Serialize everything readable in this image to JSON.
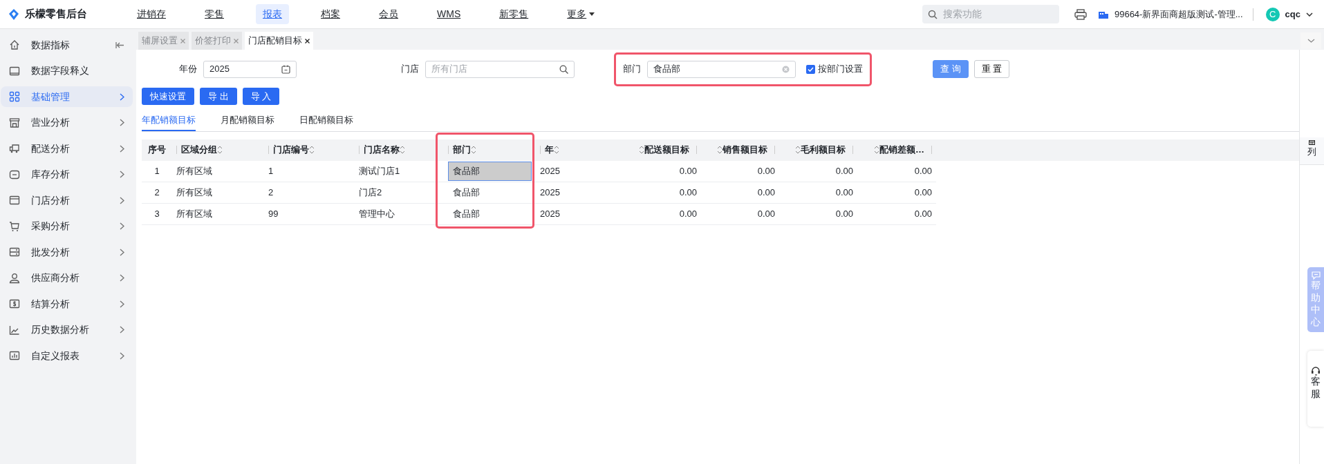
{
  "app": {
    "title": "乐檬零售后台"
  },
  "top_nav": [
    {
      "label": "进销存",
      "selected": false,
      "kind": "link"
    },
    {
      "label": "零售",
      "selected": false,
      "kind": "link"
    },
    {
      "label": "报表",
      "selected": true,
      "kind": "link"
    },
    {
      "label": "档案",
      "selected": false,
      "kind": "link"
    },
    {
      "label": "会员",
      "selected": false,
      "kind": "link"
    },
    {
      "label": "WMS",
      "selected": false,
      "kind": "link"
    },
    {
      "label": "新零售",
      "selected": false,
      "kind": "link"
    },
    {
      "label": "更多",
      "selected": false,
      "kind": "dropdown"
    }
  ],
  "search": {
    "placeholder": "搜索功能"
  },
  "store": {
    "name": "99664-新界面商超版测试-管理..."
  },
  "user": {
    "initial": "C",
    "name": "cqc"
  },
  "sidebar": {
    "items": [
      {
        "label": "数据指标",
        "selected": false,
        "kind": "collapse"
      },
      {
        "label": "数据字段释义",
        "selected": false,
        "kind": "plain"
      },
      {
        "label": "基础管理",
        "selected": true,
        "kind": "submenu"
      },
      {
        "label": "营业分析",
        "selected": false,
        "kind": "submenu"
      },
      {
        "label": "配送分析",
        "selected": false,
        "kind": "submenu"
      },
      {
        "label": "库存分析",
        "selected": false,
        "kind": "submenu"
      },
      {
        "label": "门店分析",
        "selected": false,
        "kind": "submenu"
      },
      {
        "label": "采购分析",
        "selected": false,
        "kind": "submenu"
      },
      {
        "label": "批发分析",
        "selected": false,
        "kind": "submenu"
      },
      {
        "label": "供应商分析",
        "selected": false,
        "kind": "submenu"
      },
      {
        "label": "结算分析",
        "selected": false,
        "kind": "submenu"
      },
      {
        "label": "历史数据分析",
        "selected": false,
        "kind": "submenu"
      },
      {
        "label": "自定义报表",
        "selected": false,
        "kind": "submenu"
      }
    ]
  },
  "tabs": [
    {
      "label": "辅屏设置",
      "selected": false
    },
    {
      "label": "价签打印",
      "selected": false
    },
    {
      "label": "门店配销目标",
      "selected": true
    }
  ],
  "filters": {
    "year": {
      "label": "年份",
      "value": "2025"
    },
    "store": {
      "label": "门店",
      "placeholder": "所有门店"
    },
    "department": {
      "label": "部门",
      "value": "食品部",
      "highlighted": true
    },
    "by_department": {
      "label": "按部门设置",
      "checked": true
    }
  },
  "query_buttons": [
    {
      "label": "查 询",
      "kind": "primary"
    },
    {
      "label": "重 置",
      "kind": "outline"
    }
  ],
  "actions": [
    {
      "label": "快速设置"
    },
    {
      "label": "导 出"
    },
    {
      "label": "导 入"
    }
  ],
  "subtabs": [
    {
      "label": "年配销额目标",
      "selected": true
    },
    {
      "label": "月配销额目标",
      "selected": false
    },
    {
      "label": "日配销额目标",
      "selected": false
    }
  ],
  "table": {
    "columns": [
      {
        "label": "序号",
        "kind": "index",
        "sortable": false,
        "highlighted": false
      },
      {
        "label": "区域分组",
        "kind": "text",
        "sortable": true,
        "highlighted": false
      },
      {
        "label": "门店编号",
        "kind": "text",
        "sortable": true,
        "highlighted": false
      },
      {
        "label": "门店名称",
        "kind": "text",
        "sortable": true,
        "highlighted": false
      },
      {
        "label": "部门",
        "kind": "text",
        "sortable": true,
        "highlighted": true
      },
      {
        "label": "年",
        "kind": "text",
        "sortable": true,
        "highlighted": false
      },
      {
        "label": "配送额目标",
        "kind": "number",
        "sortable": true,
        "highlighted": false
      },
      {
        "label": "销售额目标",
        "kind": "number",
        "sortable": true,
        "highlighted": false
      },
      {
        "label": "毛利额目标",
        "kind": "number",
        "sortable": true,
        "highlighted": false
      },
      {
        "label": "配销差额…",
        "kind": "number",
        "sortable": true,
        "highlighted": false
      }
    ],
    "rows": [
      {
        "cells": [
          "1",
          "所有区域",
          "1",
          "测试门店1",
          "食品部",
          "2025",
          "0.00",
          "0.00",
          "0.00",
          "0.00"
        ],
        "department_selected": true
      },
      {
        "cells": [
          "2",
          "所有区域",
          "2",
          "门店2",
          "食品部",
          "2025",
          "0.00",
          "0.00",
          "0.00",
          "0.00"
        ],
        "department_selected": false
      },
      {
        "cells": [
          "3",
          "所有区域",
          "99",
          "管理中心",
          "食品部",
          "2025",
          "0.00",
          "0.00",
          "0.00",
          "0.00"
        ],
        "department_selected": false
      }
    ]
  },
  "column_settings": {
    "label": "列"
  },
  "help": {
    "label": "帮助中心"
  },
  "service": {
    "label": "客服"
  }
}
